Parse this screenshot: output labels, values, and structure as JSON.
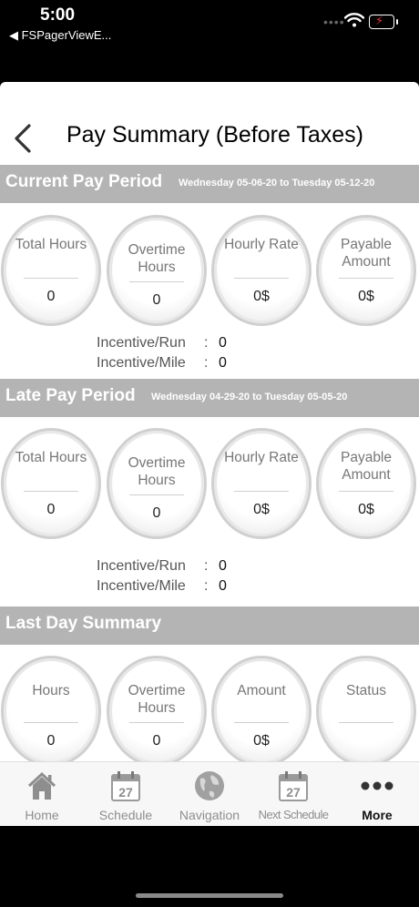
{
  "status_bar": {
    "time": "5:00",
    "back_app": "◀ FSPagerViewE..."
  },
  "header": {
    "title": "Pay Summary (Before Taxes)"
  },
  "current_period": {
    "title": "Current Pay Period",
    "range": "Wednesday 05-06-20 to Tuesday 05-12-20",
    "stats": [
      {
        "label": "Total Hours",
        "value": "0"
      },
      {
        "label": "Overtime Hours",
        "value": "0"
      },
      {
        "label": "Hourly Rate",
        "value": "0$"
      },
      {
        "label": "Payable Amount",
        "value": "0$"
      }
    ],
    "incentives": [
      {
        "label": "Incentive/Run",
        "value": "0"
      },
      {
        "label": "Incentive/Mile",
        "value": "0"
      }
    ]
  },
  "late_period": {
    "title": "Late Pay Period",
    "range": "Wednesday 04-29-20 to Tuesday 05-05-20",
    "stats": [
      {
        "label": "Total Hours",
        "value": "0"
      },
      {
        "label": "Overtime Hours",
        "value": "0"
      },
      {
        "label": "Hourly Rate",
        "value": "0$"
      },
      {
        "label": "Payable Amount",
        "value": "0$"
      }
    ],
    "incentives": [
      {
        "label": "Incentive/Run",
        "value": "0"
      },
      {
        "label": "Incentive/Mile",
        "value": "0"
      }
    ]
  },
  "last_day": {
    "title": "Last Day Summary",
    "stats": [
      {
        "label": "Hours",
        "value": "0"
      },
      {
        "label": "Overtime Hours",
        "value": "0"
      },
      {
        "label": "Amount",
        "value": "0$"
      },
      {
        "label": "Status",
        "value": ""
      }
    ]
  },
  "tab_bar": {
    "calendar_day": "27",
    "items": [
      {
        "label": "Home",
        "icon": "home-icon"
      },
      {
        "label": "Schedule",
        "icon": "calendar-icon"
      },
      {
        "label": "Navigation",
        "icon": "globe-icon"
      },
      {
        "label": "Next Schedule",
        "icon": "calendar-icon"
      },
      {
        "label": "More",
        "icon": "more-dots-icon"
      }
    ],
    "active_index": 4
  },
  "colors": {
    "section_header_bg": "#b4b4b4",
    "tab_active": "#111111",
    "tab_inactive": "#8e8e8e"
  }
}
